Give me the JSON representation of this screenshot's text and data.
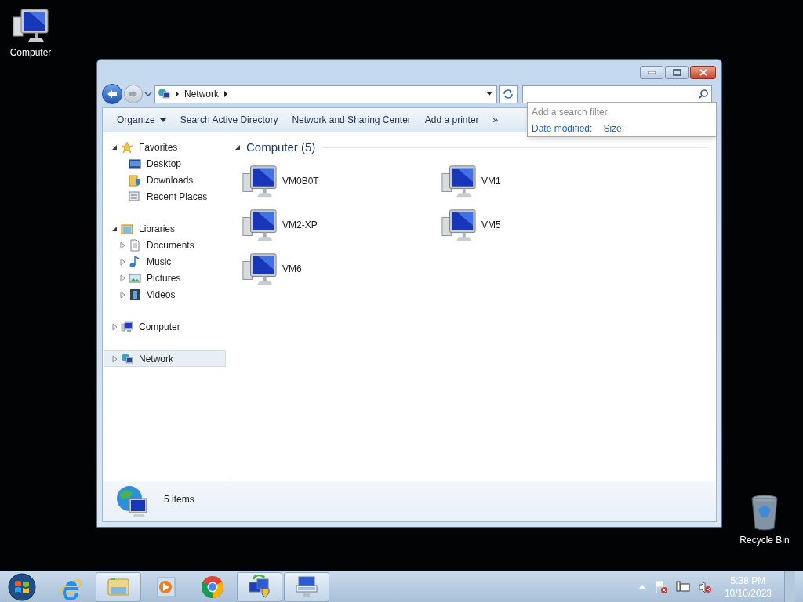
{
  "desktop_icons": [
    {
      "label": "Computer",
      "kind": "computer"
    },
    {
      "label": "Recycle Bin",
      "kind": "recycle-bin"
    }
  ],
  "window": {
    "address": {
      "segments": [
        "Network"
      ]
    },
    "search_dropdown": {
      "title": "Add a search filter",
      "filters": [
        "Date modified:",
        "Size:"
      ]
    },
    "toolbar": {
      "buttons": [
        {
          "label": "Organize",
          "kind": "menu"
        },
        {
          "label": "Search Active Directory",
          "kind": "plain"
        },
        {
          "label": "Network and Sharing Center",
          "kind": "plain"
        },
        {
          "label": "Add a printer",
          "kind": "plain"
        }
      ],
      "overflow": "»"
    },
    "navigation": [
      {
        "label": "Favorites",
        "kind": "star",
        "expanded": true,
        "selected": false,
        "children": [
          {
            "label": "Desktop",
            "kind": "desktop",
            "selected": false
          },
          {
            "label": "Downloads",
            "kind": "downloads",
            "selected": false
          },
          {
            "label": "Recent Places",
            "kind": "recent",
            "selected": false
          }
        ]
      },
      {
        "label": "Libraries",
        "kind": "libraries",
        "expanded": true,
        "selected": false,
        "children": [
          {
            "label": "Documents",
            "kind": "documents",
            "expanded": false,
            "selected": false
          },
          {
            "label": "Music",
            "kind": "music",
            "expanded": false,
            "selected": false
          },
          {
            "label": "Pictures",
            "kind": "pictures",
            "expanded": false,
            "selected": false
          },
          {
            "label": "Videos",
            "kind": "videos",
            "expanded": false,
            "selected": false
          }
        ]
      },
      {
        "label": "Computer",
        "kind": "computer",
        "expanded": false,
        "selected": false
      },
      {
        "label": "Network",
        "kind": "network",
        "expanded": false,
        "selected": true
      }
    ],
    "group": {
      "title": "Computer (5)",
      "expanded": true,
      "items": [
        "VM0B0T",
        "VM1",
        "VM2-XP",
        "VM5",
        "VM6"
      ]
    },
    "status_bar": {
      "text": "5 items"
    }
  },
  "taskbar": {
    "apps": [
      {
        "kind": "ie",
        "active": false
      },
      {
        "kind": "explorer",
        "active": true
      },
      {
        "kind": "media",
        "active": false
      },
      {
        "kind": "chrome",
        "active": false
      },
      {
        "kind": "network-update",
        "active": true
      },
      {
        "kind": "remote-keyboard",
        "active": true
      }
    ],
    "tray": {
      "time": "5:38 PM",
      "date": "10/10/2023"
    }
  }
}
